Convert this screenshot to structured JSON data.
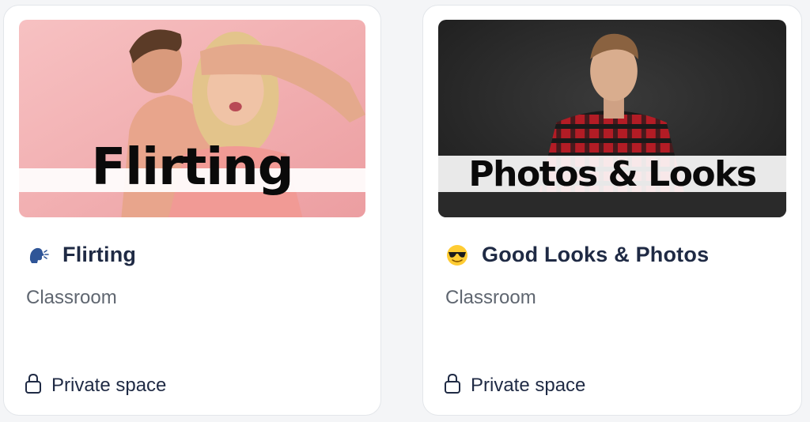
{
  "cards": [
    {
      "thumbnail_text": "Flirting",
      "emoji": "speaking-head-emoji",
      "title": "Flirting",
      "subtitle": "Classroom",
      "privacy_icon": "lock-icon",
      "privacy_label": "Private space",
      "accent": "#f2b6b6"
    },
    {
      "thumbnail_text": "Photos & Looks",
      "emoji": "sunglasses-emoji",
      "title": "Good Looks & Photos",
      "subtitle": "Classroom",
      "privacy_icon": "lock-icon",
      "privacy_label": "Private space",
      "accent": "#2a2a2a"
    }
  ]
}
